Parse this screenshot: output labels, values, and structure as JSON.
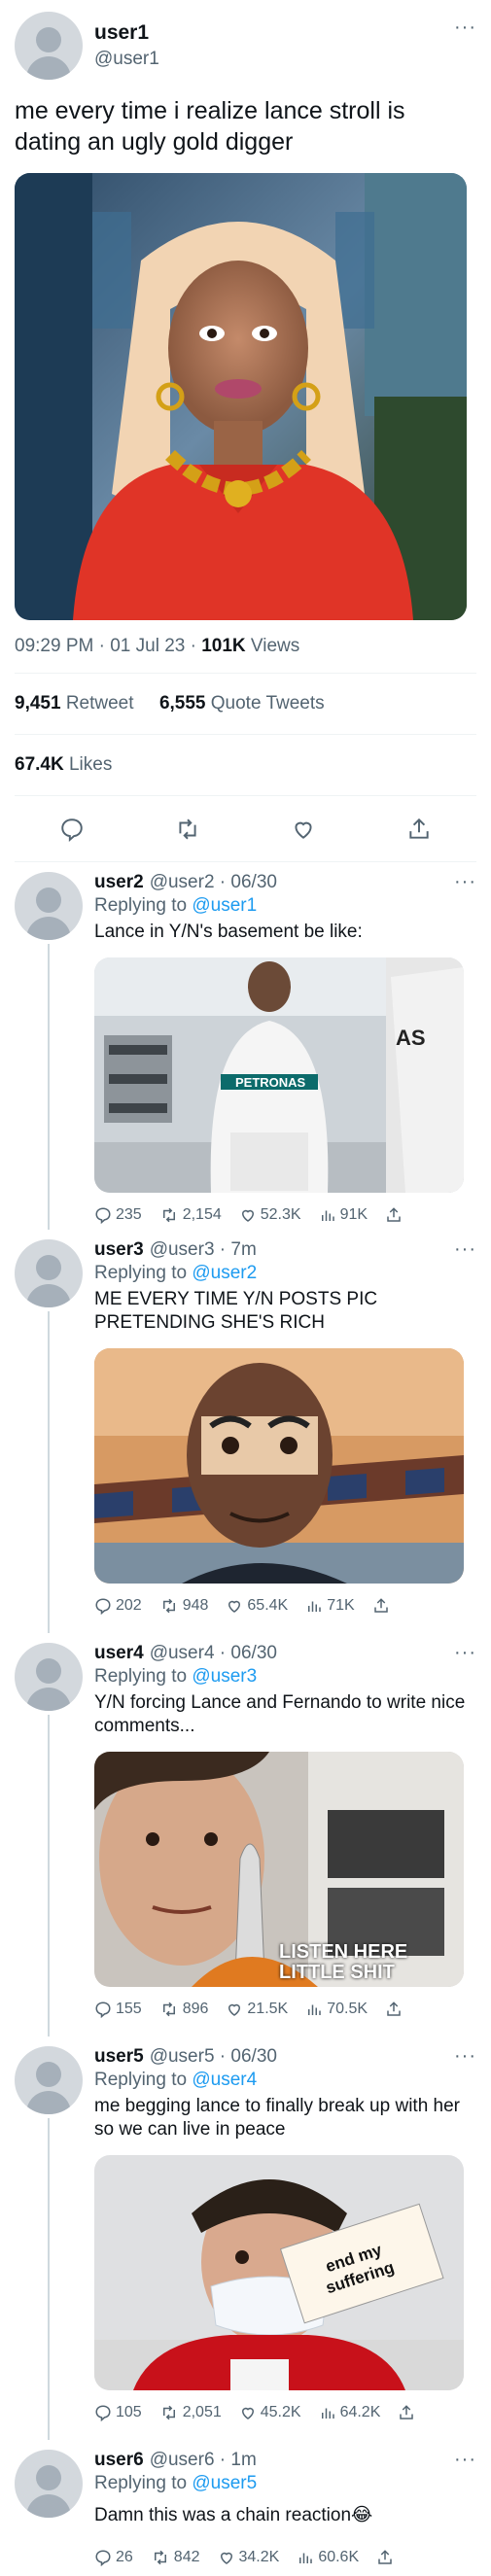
{
  "main_tweet": {
    "name": "user1",
    "handle": "@user1",
    "text": "me every time i realize lance stroll is dating an ugly gold digger",
    "time": "09:29 PM · 01 Jul 23 · ",
    "views_count": "101K",
    "views_label": " Views",
    "retweets_count": "9,451",
    "retweets_label": " Retweet",
    "quotes_count": "6,555",
    "quotes_label": " Quote Tweets",
    "likes_count": "67.4K",
    "likes_label": " Likes",
    "more": "···"
  },
  "replies": [
    {
      "name": "user2",
      "handle": "@user2 · 06/30",
      "replying_prefix": "Replying to ",
      "replying_to": "@user1",
      "text": "Lance in Y/N's basement be like:",
      "media_caption": "",
      "comments": "235",
      "retweets": "2,154",
      "likes": "52.3K",
      "views": "91K"
    },
    {
      "name": "user3",
      "handle": "@user3 · 7m",
      "replying_prefix": "Replying to ",
      "replying_to": "@user2",
      "text": "ME EVERY TIME Y/N POSTS PIC PRETENDING SHE'S RICH",
      "media_caption": "",
      "comments": "202",
      "retweets": "948",
      "likes": "65.4K",
      "views": "71K"
    },
    {
      "name": "user4",
      "handle": "@user4 · 06/30",
      "replying_prefix": "Replying to ",
      "replying_to": "@user3",
      "text": "Y/N forcing Lance and Fernando to write nice comments...",
      "media_caption": "LISTEN HERE LITTLE SHIT",
      "comments": "155",
      "retweets": "896",
      "likes": "21.5K",
      "views": "70.5K"
    },
    {
      "name": "user5",
      "handle": "@user5 · 06/30",
      "replying_prefix": "Replying to ",
      "replying_to": "@user4",
      "text": "me begging lance to finally break up with her so we can live in peace",
      "media_caption": "end my suffering",
      "comments": "105",
      "retweets": "2,051",
      "likes": "45.2K",
      "views": "64.2K"
    },
    {
      "name": "user6",
      "handle": "@user6 · 1m",
      "replying_prefix": "Replying to ",
      "replying_to": "@user5",
      "text": "Damn this was a chain reaction😂",
      "media_caption": "",
      "comments": "26",
      "retweets": "842",
      "likes": "34.2K",
      "views": "60.6K"
    }
  ],
  "icons": {
    "comment": "comment-icon",
    "retweet": "retweet-icon",
    "like": "heart-icon",
    "views": "views-icon",
    "share": "share-icon"
  },
  "colors": {
    "link": "#1d9bf0",
    "muted": "#536471",
    "text": "#0f1419"
  }
}
